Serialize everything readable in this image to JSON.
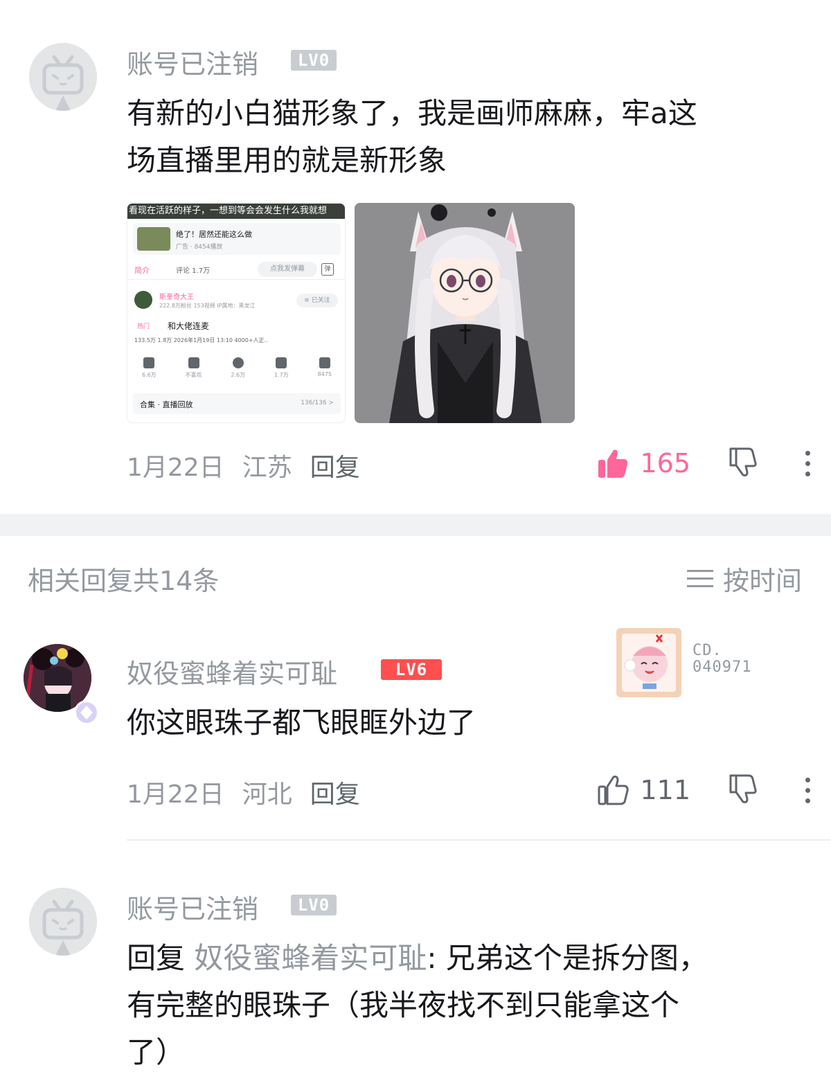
{
  "comment1": {
    "username": "账号已注销",
    "level": "LV0",
    "text_line1": "有新的小白猫形象了，我是画师麻麻，牢a这",
    "text_line2": "场直播里用的就是新形象",
    "date": "1月22日",
    "location": "江苏",
    "reply_label": "回复",
    "likes": "165",
    "liked": true,
    "screenshot": {
      "banner": "看现在活跃的样子，一想到等会会发生什么我就想",
      "ad_title": "绝了！居然还能这么做",
      "ad_sub": "广告 · 8454播放",
      "tab_intro": "简介",
      "tab_comments": "评论 1.7万",
      "danmu_placeholder": "点我发弹幕",
      "danmu_button": "弹",
      "up_name": "斯奎奇大王",
      "up_fans": "222.8万粉丝  153视频  IP属地：黑龙江",
      "follow": "≡ 已关注",
      "hot_tag": "热门",
      "video_title": "和大佬连麦",
      "video_stats": "133.5万  1.8万  2026年1月19日 13:10  4000+人正..",
      "actions": [
        "6.6万",
        "不喜欢",
        "2.6万",
        "1.7万",
        "8475"
      ],
      "collection_label": "合集 · 直播回放",
      "collection_count": "136/136 >"
    }
  },
  "replies_header": {
    "title": "相关回复共14条",
    "sort_label": "按时间"
  },
  "comment2": {
    "username": "奴役蜜蜂着实可耻",
    "level": "LV6",
    "badge_code_line1": "CD.",
    "badge_code_line2": "040971",
    "text": "你这眼珠子都飞眼眶外边了",
    "date": "1月22日",
    "location": "河北",
    "reply_label": "回复",
    "likes": "111",
    "liked": false
  },
  "comment3": {
    "username": "账号已注销",
    "level": "LV0",
    "reply_prefix": "回复 ",
    "reply_target": "奴役蜜蜂着实可耻",
    "text_after_target": ": 兄弟这个是拆分图，",
    "text_line2": "有完整的眼珠子（我半夜找不到只能拿这个",
    "text_line3": "了）"
  },
  "colors": {
    "accent_pink": "#ff6699",
    "level6_red": "#ff4f4f",
    "secondary_text": "#9499a0",
    "divider": "#f1f2f3"
  }
}
